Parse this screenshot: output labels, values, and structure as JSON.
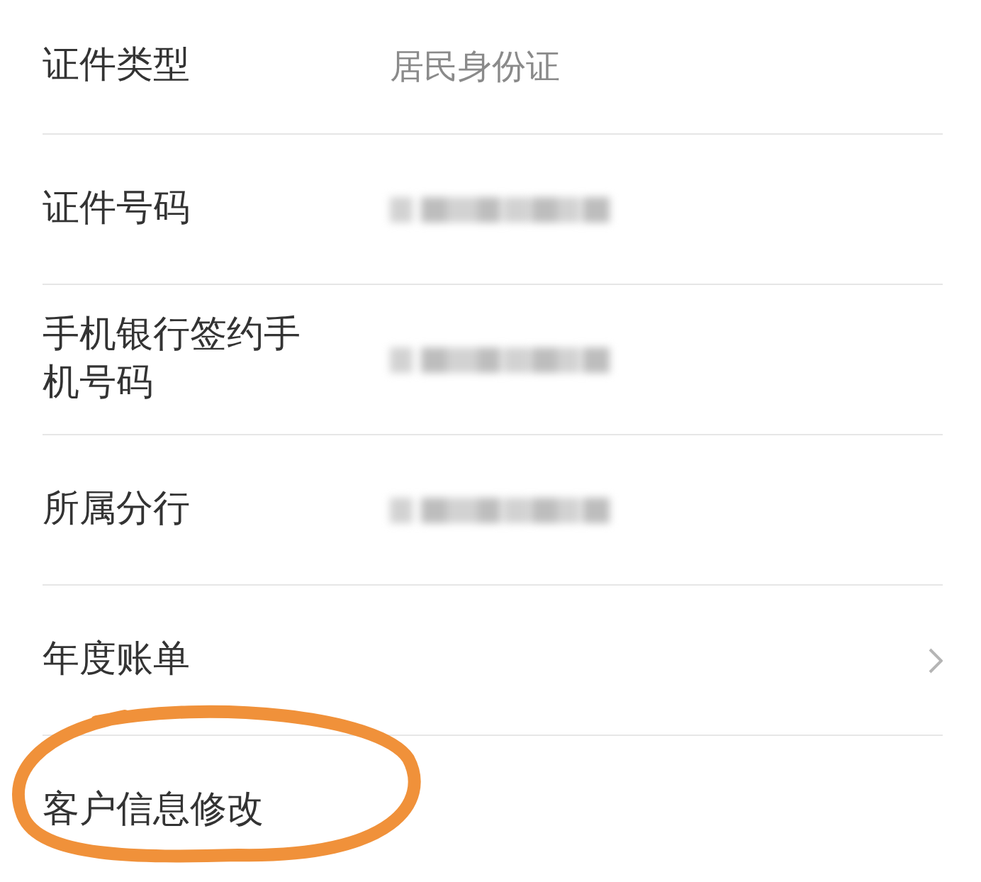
{
  "rows": [
    {
      "label": "证件类型",
      "kind": "text",
      "value": "居民身份证",
      "highlighted": false
    },
    {
      "label": "证件号码",
      "kind": "masked",
      "highlighted": false
    },
    {
      "label": "手机银行签约手机号码",
      "kind": "masked",
      "highlighted": false
    },
    {
      "label": "所属分行",
      "kind": "masked",
      "highlighted": false
    },
    {
      "label": "年度账单",
      "kind": "link",
      "highlighted": false
    },
    {
      "label": "客户信息修改",
      "kind": "plain",
      "highlighted": true
    }
  ]
}
